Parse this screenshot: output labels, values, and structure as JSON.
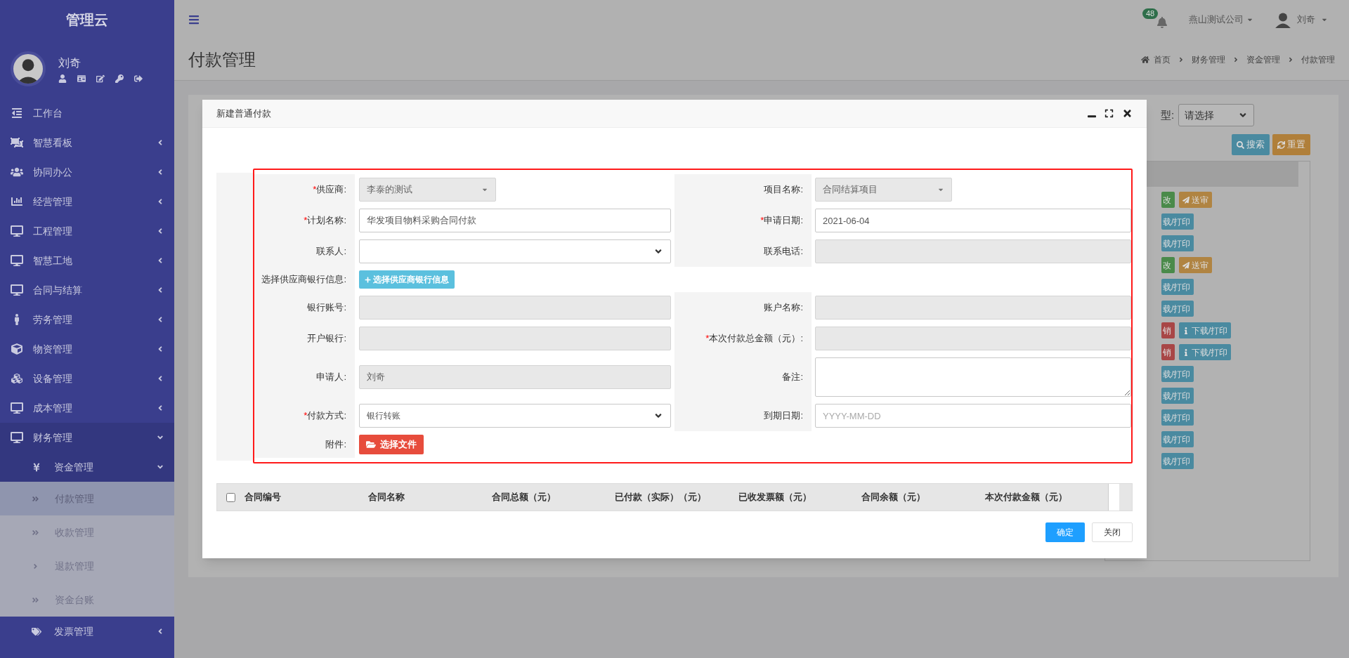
{
  "sidebar": {
    "brand": "管理云",
    "user": {
      "name": "刘奇"
    },
    "items": [
      {
        "label": "工作台",
        "expanded": false,
        "selected": false,
        "has_arrow": false
      },
      {
        "label": "智慧看板",
        "expanded": false,
        "selected": false,
        "has_arrow": true
      },
      {
        "label": "协同办公",
        "expanded": false,
        "selected": false,
        "has_arrow": true
      },
      {
        "label": "经营管理",
        "expanded": false,
        "selected": false,
        "has_arrow": true
      },
      {
        "label": "工程管理",
        "expanded": false,
        "selected": false,
        "has_arrow": true
      },
      {
        "label": "智慧工地",
        "expanded": false,
        "selected": false,
        "has_arrow": true
      },
      {
        "label": "合同与结算",
        "expanded": false,
        "selected": false,
        "has_arrow": true
      },
      {
        "label": "劳务管理",
        "expanded": false,
        "selected": false,
        "has_arrow": true
      },
      {
        "label": "物资管理",
        "expanded": false,
        "selected": false,
        "has_arrow": true
      },
      {
        "label": "设备管理",
        "expanded": false,
        "selected": false,
        "has_arrow": true
      },
      {
        "label": "成本管理",
        "expanded": false,
        "selected": false,
        "has_arrow": true
      },
      {
        "label": "财务管理",
        "expanded": true,
        "selected": false,
        "has_arrow": true,
        "children": [
          {
            "label": "资金管理",
            "expanded": true,
            "selected": false,
            "children": [
              {
                "label": "付款管理",
                "selected": true
              },
              {
                "label": "收款管理",
                "selected": false
              },
              {
                "label": "退款管理",
                "selected": false
              },
              {
                "label": "资金台账",
                "selected": false
              }
            ]
          },
          {
            "label": "发票管理",
            "expanded": false,
            "selected": false
          }
        ]
      }
    ]
  },
  "header": {
    "notifications": "48",
    "company": "燕山测试公司",
    "user": "刘奇"
  },
  "page": {
    "title": "付款管理",
    "breadcrumb": [
      "首页",
      "财务管理",
      "资金管理",
      "付款管理"
    ]
  },
  "background": {
    "filter_label": "型:",
    "filter_select": "请选择",
    "buttons": [
      {
        "label": "搜索",
        "kind": "search"
      },
      {
        "label": "重置",
        "kind": "reset"
      }
    ],
    "row_actions": [
      [
        {
          "label": "改",
          "kind": "edit"
        },
        {
          "label": "送审",
          "kind": "submit"
        }
      ],
      [
        {
          "label": "载/打印",
          "kind": "print"
        }
      ],
      [
        {
          "label": "载/打印",
          "kind": "print"
        }
      ],
      [
        {
          "label": "改",
          "kind": "edit"
        },
        {
          "label": "送审",
          "kind": "submit"
        }
      ],
      [
        {
          "label": "载/打印",
          "kind": "print"
        }
      ],
      [
        {
          "label": "载/打印",
          "kind": "print"
        }
      ],
      [
        {
          "label": "销",
          "kind": "revoke"
        },
        {
          "label": "下载/打印",
          "kind": "print_full"
        }
      ],
      [
        {
          "label": "销",
          "kind": "revoke"
        },
        {
          "label": "下载/打印",
          "kind": "print_full"
        }
      ],
      [
        {
          "label": "载/打印",
          "kind": "print"
        }
      ],
      [
        {
          "label": "载/打印",
          "kind": "print"
        }
      ],
      [
        {
          "label": "载/打印",
          "kind": "print"
        }
      ],
      [
        {
          "label": "载/打印",
          "kind": "print"
        }
      ],
      [
        {
          "label": "载/打印",
          "kind": "print"
        }
      ]
    ]
  },
  "modal": {
    "title": "新建普通付款",
    "rows": [
      {
        "left": {
          "mark": "*",
          "label": "供应商:",
          "kind": "dropdown",
          "value": "李泰的测试",
          "disabled": true
        },
        "right": {
          "label": "项目名称:",
          "kind": "dropdown",
          "value": "合同结算项目",
          "disabled": true
        }
      },
      {
        "left": {
          "mark": "*",
          "label": "计划名称:",
          "kind": "input",
          "value": "华发项目物料采购合同付款",
          "disabled": false
        },
        "right": {
          "mark": "*",
          "label": "申请日期:",
          "kind": "input",
          "value": "2021-06-04",
          "disabled": false
        }
      },
      {
        "left": {
          "label": "联系人:",
          "kind": "select"
        },
        "right": {
          "label": "联系电话:",
          "kind": "input",
          "disabled": true
        }
      },
      {
        "left": {
          "label": "选择供应商银行信息:",
          "kind": "button",
          "value": "选择供应商银行信息"
        }
      },
      {
        "left": {
          "label": "银行账号:",
          "kind": "input",
          "disabled": true
        },
        "right": {
          "label": "账户名称:",
          "kind": "input",
          "disabled": true
        }
      },
      {
        "left": {
          "label": "开户银行:",
          "kind": "input",
          "disabled": true
        },
        "right": {
          "mark": "*",
          "label": "本次付款总金额（元）:",
          "kind": "input",
          "disabled": true
        }
      },
      {
        "left": {
          "label": "申请人:",
          "kind": "input",
          "value": "刘奇",
          "disabled": true
        },
        "right": {
          "label": "备注:",
          "kind": "textarea",
          "disabled": false
        }
      },
      {
        "left": {
          "mark": "*",
          "label": "付款方式:",
          "kind": "select",
          "value": "银行转账"
        },
        "right": {
          "label": "到期日期:",
          "kind": "input",
          "placeholder": "YYYY-MM-DD",
          "disabled": false
        }
      },
      {
        "left": {
          "label": "附件:",
          "kind": "file",
          "value": "选择文件"
        }
      }
    ],
    "table": {
      "checked": false,
      "columns": [
        "合同编号",
        "合同名称",
        "合同总额（元）",
        "已付款（实际）（元）",
        "已收发票额（元）",
        "合同余额（元）",
        "本次付款金额（元）"
      ]
    },
    "buttons": [
      {
        "label": "确定",
        "kind": "primary"
      },
      {
        "label": "关闭",
        "kind": "default"
      }
    ]
  }
}
